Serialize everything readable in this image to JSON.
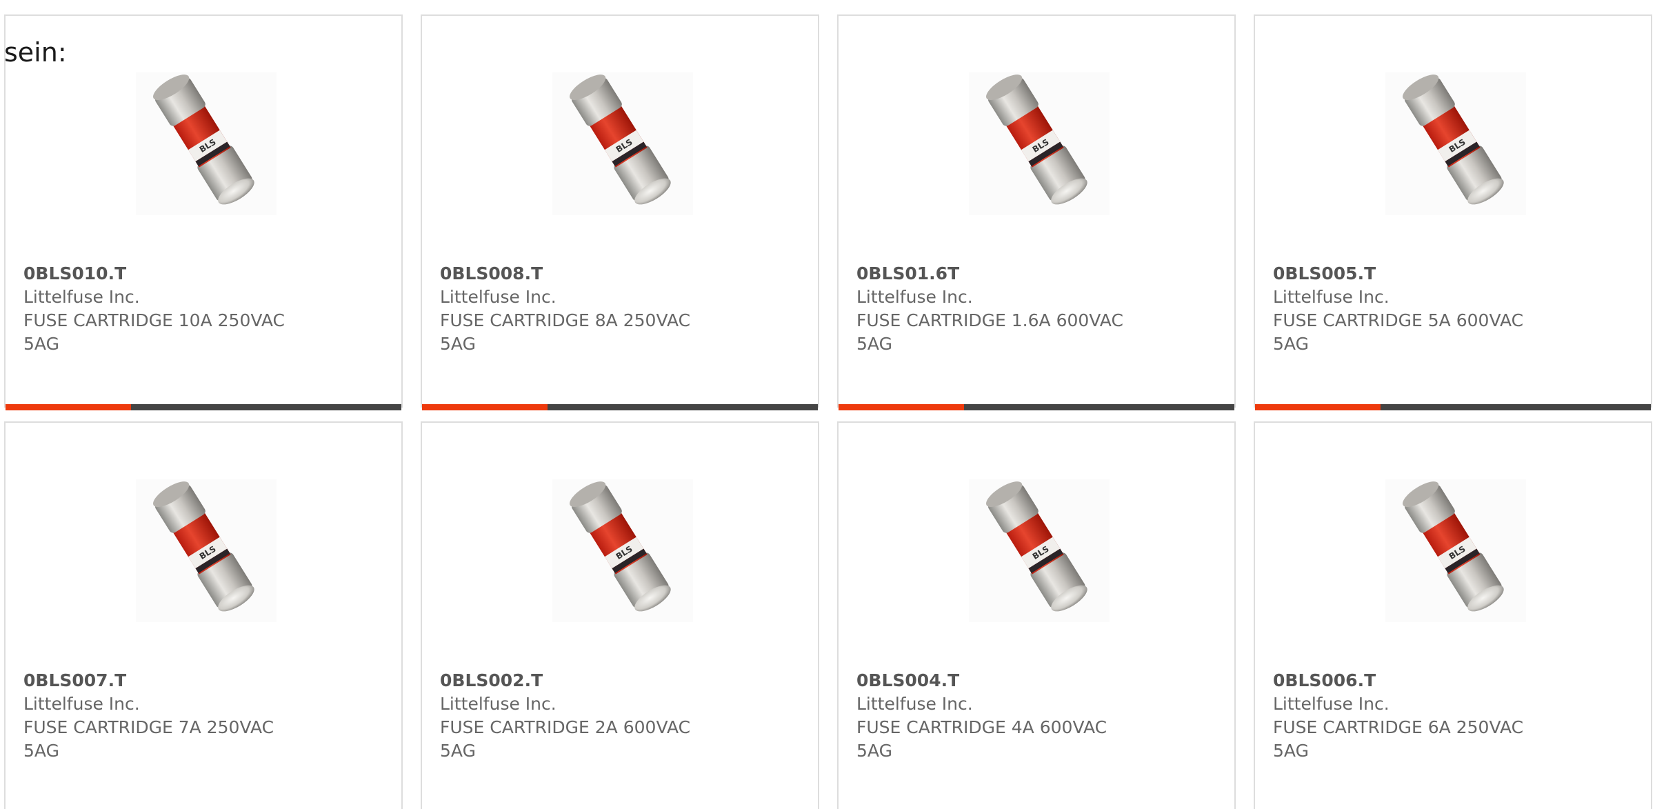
{
  "intro_text": "sein:",
  "products": [
    {
      "part": "0BLS010.T",
      "maker": "Littelfuse Inc.",
      "desc_line1": "FUSE CARTRIDGE 10A 250VAC",
      "desc_line2": "5AG"
    },
    {
      "part": "0BLS008.T",
      "maker": "Littelfuse Inc.",
      "desc_line1": "FUSE CARTRIDGE 8A 250VAC",
      "desc_line2": "5AG"
    },
    {
      "part": "0BLS01.6T",
      "maker": "Littelfuse Inc.",
      "desc_line1": "FUSE CARTRIDGE 1.6A 600VAC",
      "desc_line2": "5AG"
    },
    {
      "part": "0BLS005.T",
      "maker": "Littelfuse Inc.",
      "desc_line1": "FUSE CARTRIDGE 5A 600VAC",
      "desc_line2": "5AG"
    },
    {
      "part": "0BLS007.T",
      "maker": "Littelfuse Inc.",
      "desc_line1": "FUSE CARTRIDGE 7A 250VAC",
      "desc_line2": "5AG"
    },
    {
      "part": "0BLS002.T",
      "maker": "Littelfuse Inc.",
      "desc_line1": "FUSE CARTRIDGE 2A 600VAC",
      "desc_line2": "5AG"
    },
    {
      "part": "0BLS004.T",
      "maker": "Littelfuse Inc.",
      "desc_line1": "FUSE CARTRIDGE 4A 600VAC",
      "desc_line2": "5AG"
    },
    {
      "part": "0BLS006.T",
      "maker": "Littelfuse Inc.",
      "desc_line1": "FUSE CARTRIDGE 6A 250VAC",
      "desc_line2": "5AG"
    }
  ],
  "colors": {
    "accent": "#ee3a0d",
    "bar": "#444444",
    "text": "#666666",
    "border": "#dddddd"
  }
}
